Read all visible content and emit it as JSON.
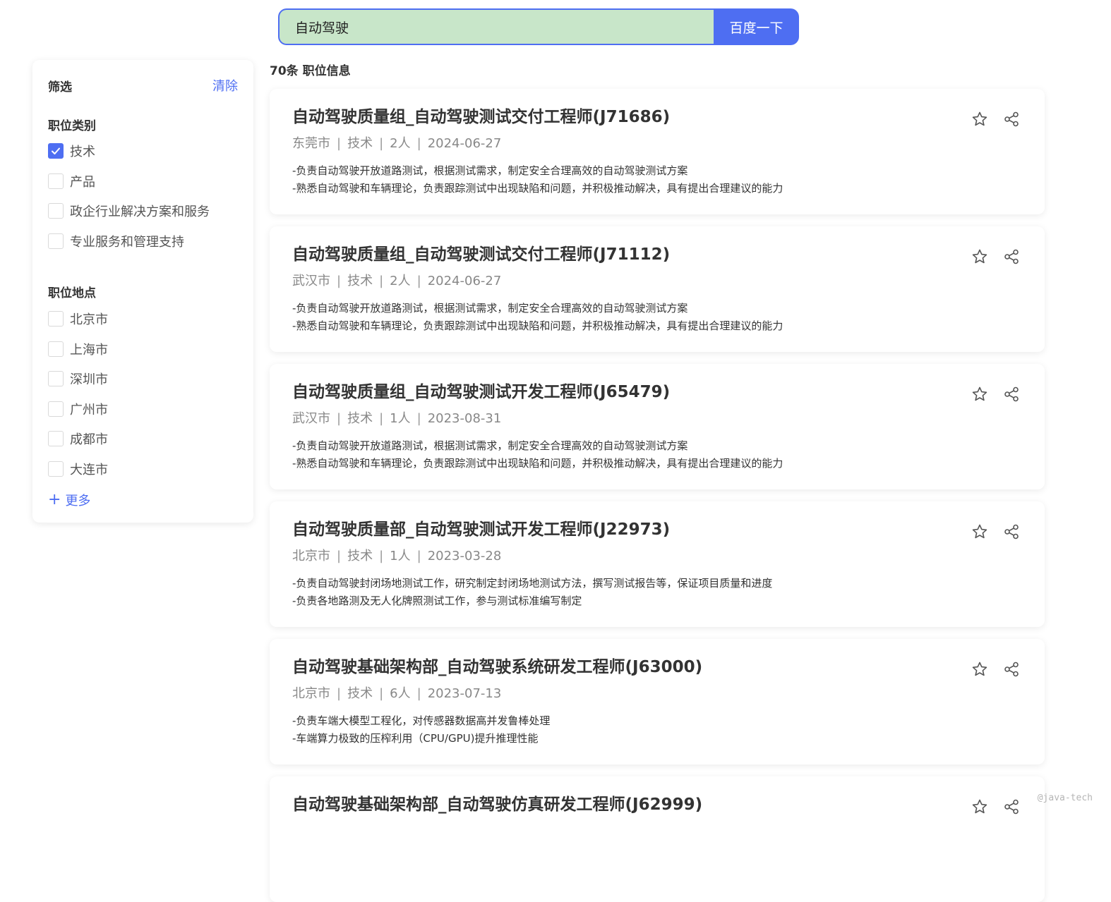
{
  "search": {
    "query": "自动驾驶",
    "button_label": "百度一下"
  },
  "sidebar": {
    "title": "筛选",
    "clear_label": "清除",
    "category": {
      "title": "职位类别",
      "options": [
        {
          "label": "技术",
          "checked": true
        },
        {
          "label": "产品",
          "checked": false
        },
        {
          "label": "政企行业解决方案和服务",
          "checked": false
        },
        {
          "label": "专业服务和管理支持",
          "checked": false
        }
      ]
    },
    "location": {
      "title": "职位地点",
      "options": [
        {
          "label": "北京市",
          "checked": false
        },
        {
          "label": "上海市",
          "checked": false
        },
        {
          "label": "深圳市",
          "checked": false
        },
        {
          "label": "广州市",
          "checked": false
        },
        {
          "label": "成都市",
          "checked": false
        },
        {
          "label": "大连市",
          "checked": false
        }
      ]
    },
    "more_icon": "+",
    "more_label": "更多"
  },
  "results": {
    "count_label": "70条 职位信息",
    "separator": "|",
    "jobs": [
      {
        "title": "自动驾驶质量组_自动驾驶测试交付工程师(J71686)",
        "city": "东莞市",
        "category": "技术",
        "headcount": "2人",
        "date": "2024-06-27",
        "desc": [
          "-负责自动驾驶开放道路测试，根据测试需求，制定安全合理高效的自动驾驶测试方案",
          "-熟悉自动驾驶和车辆理论，负责跟踪测试中出现缺陷和问题，并积极推动解决，具有提出合理建议的能力"
        ]
      },
      {
        "title": "自动驾驶质量组_自动驾驶测试交付工程师(J71112)",
        "city": "武汉市",
        "category": "技术",
        "headcount": "2人",
        "date": "2024-06-27",
        "desc": [
          "-负责自动驾驶开放道路测试，根据测试需求，制定安全合理高效的自动驾驶测试方案",
          "-熟悉自动驾驶和车辆理论，负责跟踪测试中出现缺陷和问题，并积极推动解决，具有提出合理建议的能力"
        ]
      },
      {
        "title": "自动驾驶质量组_自动驾驶测试开发工程师(J65479)",
        "city": "武汉市",
        "category": "技术",
        "headcount": "1人",
        "date": "2023-08-31",
        "desc": [
          "-负责自动驾驶开放道路测试，根据测试需求，制定安全合理高效的自动驾驶测试方案",
          "-熟悉自动驾驶和车辆理论，负责跟踪测试中出现缺陷和问题，并积极推动解决，具有提出合理建议的能力"
        ]
      },
      {
        "title": "自动驾驶质量部_自动驾驶测试开发工程师(J22973)",
        "city": "北京市",
        "category": "技术",
        "headcount": "1人",
        "date": "2023-03-28",
        "desc": [
          "-负责自动驾驶封闭场地测试工作，研究制定封闭场地测试方法，撰写测试报告等，保证项目质量和进度",
          "-负责各地路测及无人化牌照测试工作，参与测试标准编写制定"
        ]
      },
      {
        "title": "自动驾驶基础架构部_自动驾驶系统研发工程师(J63000)",
        "city": "北京市",
        "category": "技术",
        "headcount": "6人",
        "date": "2023-07-13",
        "desc": [
          "-负责车端大模型工程化，对传感器数据高并发鲁棒处理",
          "-车端算力极致的压榨利用（CPU/GPU)提升推理性能"
        ]
      },
      {
        "title": "自动驾驶基础架构部_自动驾驶仿真研发工程师(J62999)",
        "city": "",
        "category": "",
        "headcount": "",
        "date": "",
        "desc": [
          "",
          ""
        ]
      }
    ]
  },
  "icons": {
    "favorite": "star-icon",
    "share": "share-icon",
    "check": "check-icon"
  },
  "colors": {
    "accent": "#4e6ef2",
    "search_bg": "#c8e6c9"
  },
  "watermark": "@java-tech"
}
